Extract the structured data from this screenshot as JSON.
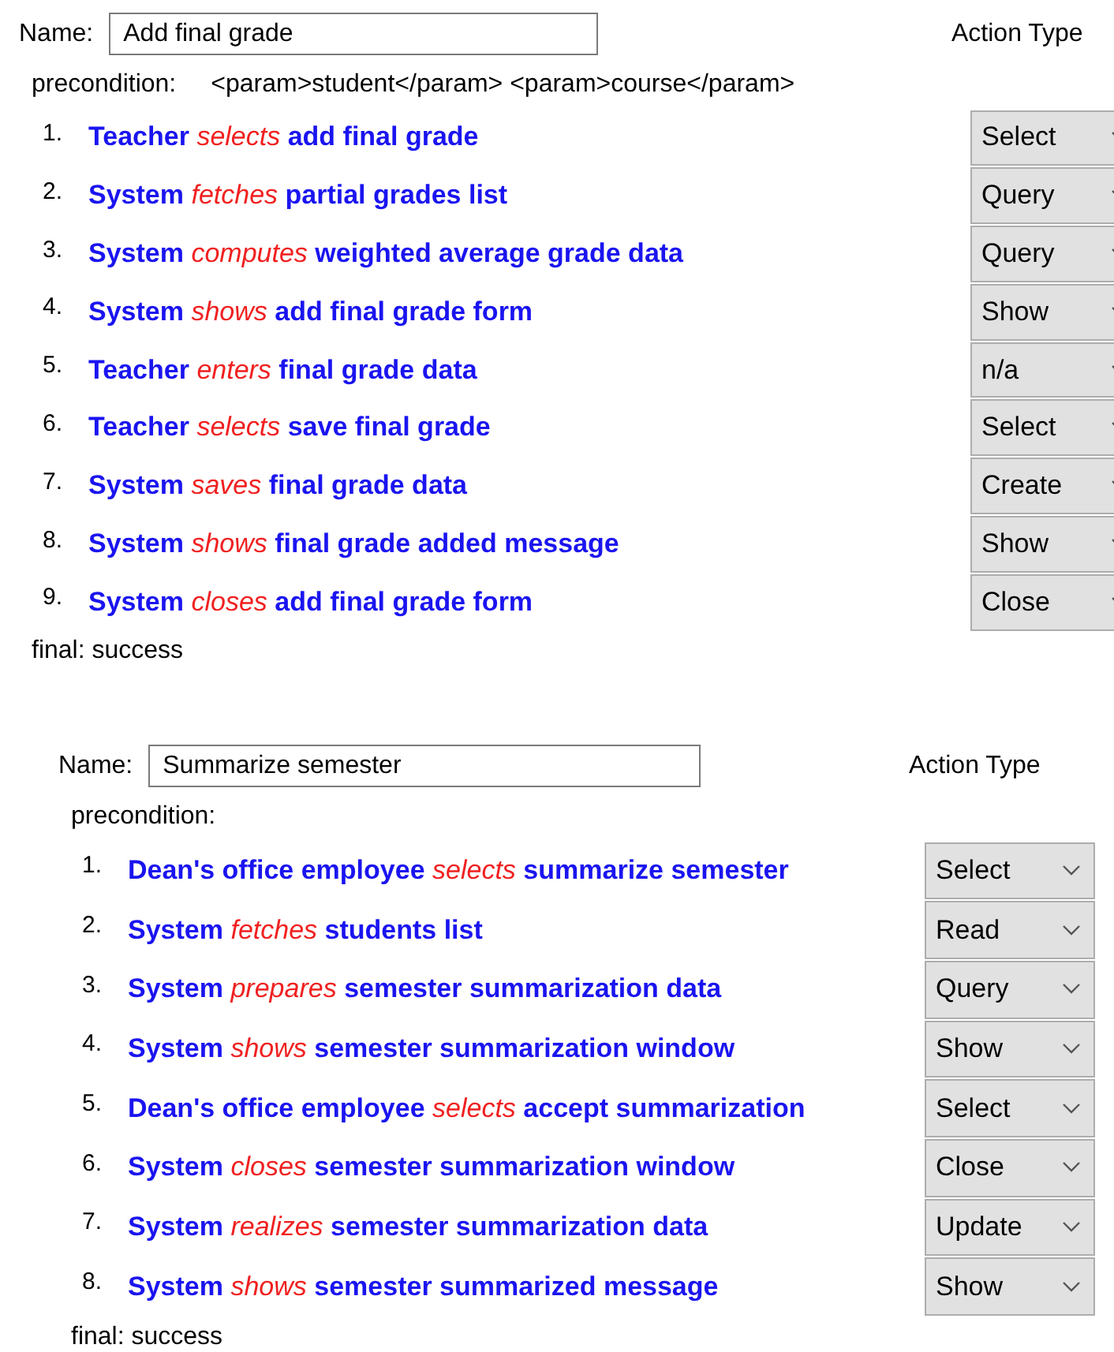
{
  "panels": [
    {
      "name_label": "Name:",
      "name": "Add final grade",
      "action_header": "Action Type",
      "precondition_label": "precondition:",
      "precondition": "<param>student</param> <param>course</param>",
      "final": "final: success",
      "steps": [
        {
          "number": "1.",
          "actor": "Teacher",
          "verb": "selects",
          "object": "add final grade",
          "action": "Select"
        },
        {
          "number": "2.",
          "actor": "System",
          "verb": "fetches",
          "object": "partial grades list",
          "action": "Query"
        },
        {
          "number": "3.",
          "actor": "System",
          "verb": "computes",
          "object": "weighted average grade data",
          "action": "Query"
        },
        {
          "number": "4.",
          "actor": "System",
          "verb": "shows",
          "object": "add final grade form",
          "action": "Show"
        },
        {
          "number": "5.",
          "actor": "Teacher",
          "verb": "enters",
          "object": "final grade data",
          "action": "n/a"
        },
        {
          "number": "6.",
          "actor": "Teacher",
          "verb": "selects",
          "object": "save final grade",
          "action": "Select"
        },
        {
          "number": "7.",
          "actor": "System",
          "verb": "saves",
          "object": "final grade data",
          "action": "Create"
        },
        {
          "number": "8.",
          "actor": "System",
          "verb": "shows",
          "object": "final grade added message",
          "action": "Show"
        },
        {
          "number": "9.",
          "actor": "System",
          "verb": "closes",
          "object": "add final grade form",
          "action": "Close"
        }
      ]
    },
    {
      "name_label": "Name:",
      "name": "Summarize semester",
      "action_header": "Action Type",
      "precondition_label": "precondition:",
      "final": "final: success",
      "steps": [
        {
          "number": "1.",
          "actor": "Dean's office employee",
          "verb": "selects",
          "object": "summarize semester",
          "action": "Select"
        },
        {
          "number": "2.",
          "actor": "System",
          "verb": "fetches",
          "object": "students list",
          "action": "Read"
        },
        {
          "number": "3.",
          "actor": "System",
          "verb": "prepares",
          "object": "semester summarization data",
          "action": "Query"
        },
        {
          "number": "4.",
          "actor": "System",
          "verb": "shows",
          "object": "semester summarization window",
          "action": "Show"
        },
        {
          "number": "5.",
          "actor": "Dean's office employee",
          "verb": "selects",
          "object": "accept summarization",
          "action": "Select"
        },
        {
          "number": "6.",
          "actor": "System",
          "verb": "closes",
          "object": "semester summarization window",
          "action": "Close"
        },
        {
          "number": "7.",
          "actor": "System",
          "verb": "realizes",
          "object": "semester summarization data",
          "action": "Update"
        },
        {
          "number": "8.",
          "actor": "System",
          "verb": "shows",
          "object": "semester summarized message",
          "action": "Show"
        }
      ]
    }
  ]
}
